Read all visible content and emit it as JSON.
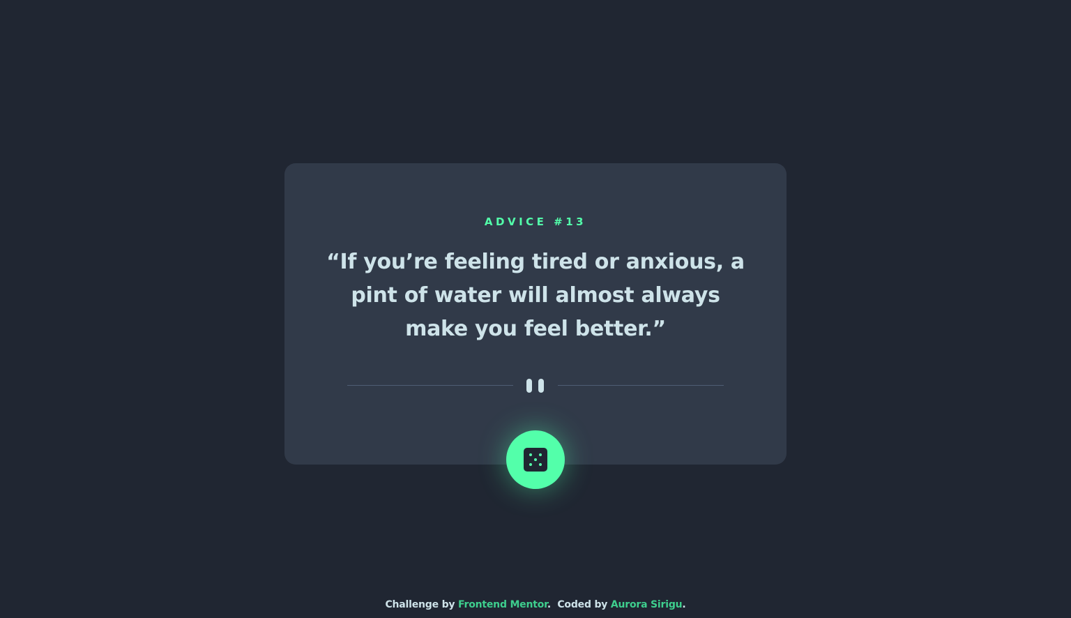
{
  "advice": {
    "label_prefix": "ADVICE #",
    "number": "13",
    "quote": "“If you’re feeling tired or anxious, a pint of water will almost always make you feel better.”"
  },
  "divider": {
    "icon": "pause-icon"
  },
  "dice_button": {
    "icon": "dice-icon"
  },
  "footer": {
    "challenge_text": "Challenge by",
    "challenge_link": "Frontend Mentor",
    "separator": ".",
    "coded_text": "Coded by",
    "coded_link": "Aurora Sirigu",
    "end": "."
  },
  "colors": {
    "background": "#202632",
    "card": "#313a49",
    "accent": "#53ffaa",
    "text": "#cee3e9",
    "divider": "#4f5d74"
  }
}
